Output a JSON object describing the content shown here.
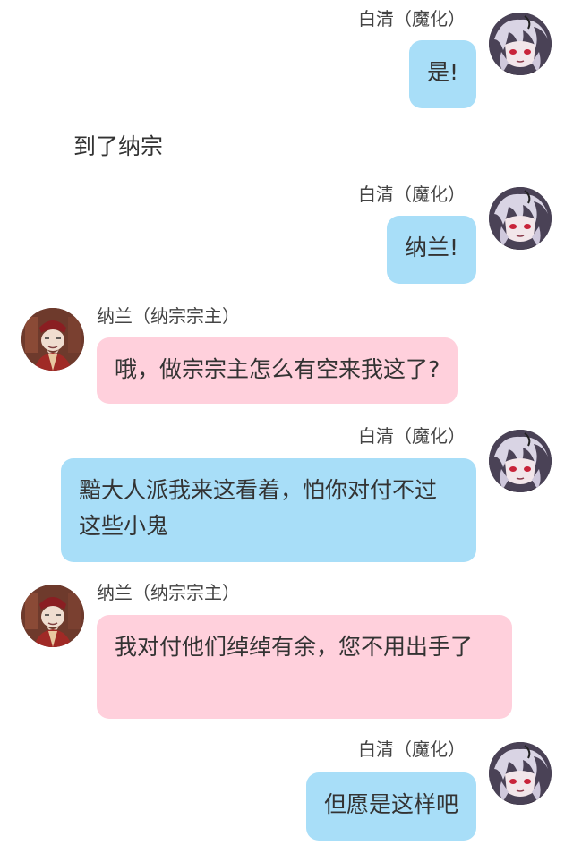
{
  "conversation": {
    "narration": "到了纳宗",
    "messages": [
      {
        "speaker": "白清（魔化）",
        "text": "是!"
      },
      {
        "speaker": "白清（魔化）",
        "text": "纳兰!"
      },
      {
        "speaker": "纳兰（纳宗宗主）",
        "text": "哦，做宗宗主怎么有空来我这了?"
      },
      {
        "speaker": "白清（魔化）",
        "text": "黯大人派我来这看着，怕你对付不过这些小鬼"
      },
      {
        "speaker": "纳兰（纳宗宗主）",
        "text": "我对付他们绰绰有余，您不用出手了"
      },
      {
        "speaker": "白清（魔化）",
        "text": "但愿是这样吧"
      }
    ]
  },
  "avatars": {
    "baiqing": "white-haired-demon-avatar",
    "nalan": "sect-master-avatar"
  },
  "colors": {
    "right_bubble": "#a8def8",
    "left_bubble": "#ffd0dc",
    "background": "#ffffff"
  }
}
